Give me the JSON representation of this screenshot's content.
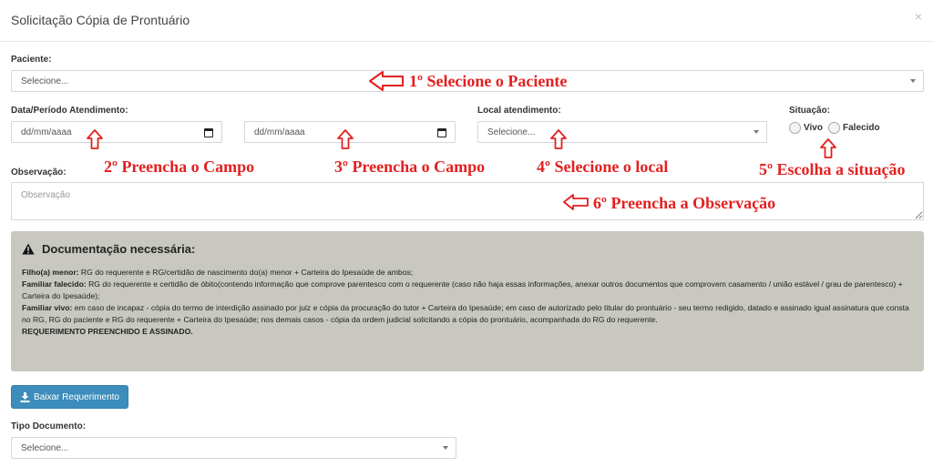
{
  "modal": {
    "title": "Solicitação Cópia de Prontuário",
    "close": "×"
  },
  "paciente": {
    "label": "Paciente:",
    "value": "Selecione..."
  },
  "data_atendimento": {
    "label": "Data/Período Atendimento:",
    "start_placeholder": "dd/mm/aaaa",
    "end_placeholder": "dd/mm/aaaa"
  },
  "local": {
    "label": "Local atendimento:",
    "value": "Selecione..."
  },
  "situacao": {
    "label": "Situação:",
    "options": [
      "Vivo",
      "Falecido"
    ]
  },
  "observacao": {
    "label": "Observação:",
    "placeholder": "Observação"
  },
  "annotations": [
    "1º Selecione o Paciente",
    "2º Preencha o Campo",
    "3º Preencha o Campo",
    "4º Selecione o local",
    "5º Escolha a situação",
    "6º Preencha a Observação"
  ],
  "documentacao": {
    "title": "Documentação necessária:",
    "items": [
      {
        "label": "Filho(a) menor:",
        "text": " RG do requerente e RG/certidão de nascimento do(a) menor + Carteira do Ipesaúde de ambos;"
      },
      {
        "label": "Familiar falecido:",
        "text": " RG do requerente e certidão de óbito(contendo informação que comprove parentesco com o requerente (caso não haja essas informações, anexar outros documentos que comprovem casamento / união estável / grau de parentesco) + Carteira do Ipesaúde);"
      },
      {
        "label": "Familiar vivo:",
        "text": " em caso de incapaz - cópia do termo de interdição assinado por juiz e cópia da procuração do tutor + Carteira do Ipesaúde; em caso de autorizado pelo titular do prontuário - seu termo redigido, datado e assinado igual assinatura que consta no RG, RG do paciente e RG do requerente + Carteira do Ipesaúde; nos demais casos - cópia da ordem judicial solicitando a cópia do prontuário, acompanhada do RG do requerente."
      }
    ],
    "footer": "REQUERIMENTO PREENCHIDO E ASSINADO."
  },
  "download_button": "Baixar Requerimento",
  "tipo_documento": {
    "label": "Tipo Documento:",
    "value": "Selecione..."
  },
  "colors": {
    "annotation": "#e32020",
    "primary_button": "#3c8dbc",
    "doc_box_bg": "#c8c8c0"
  }
}
